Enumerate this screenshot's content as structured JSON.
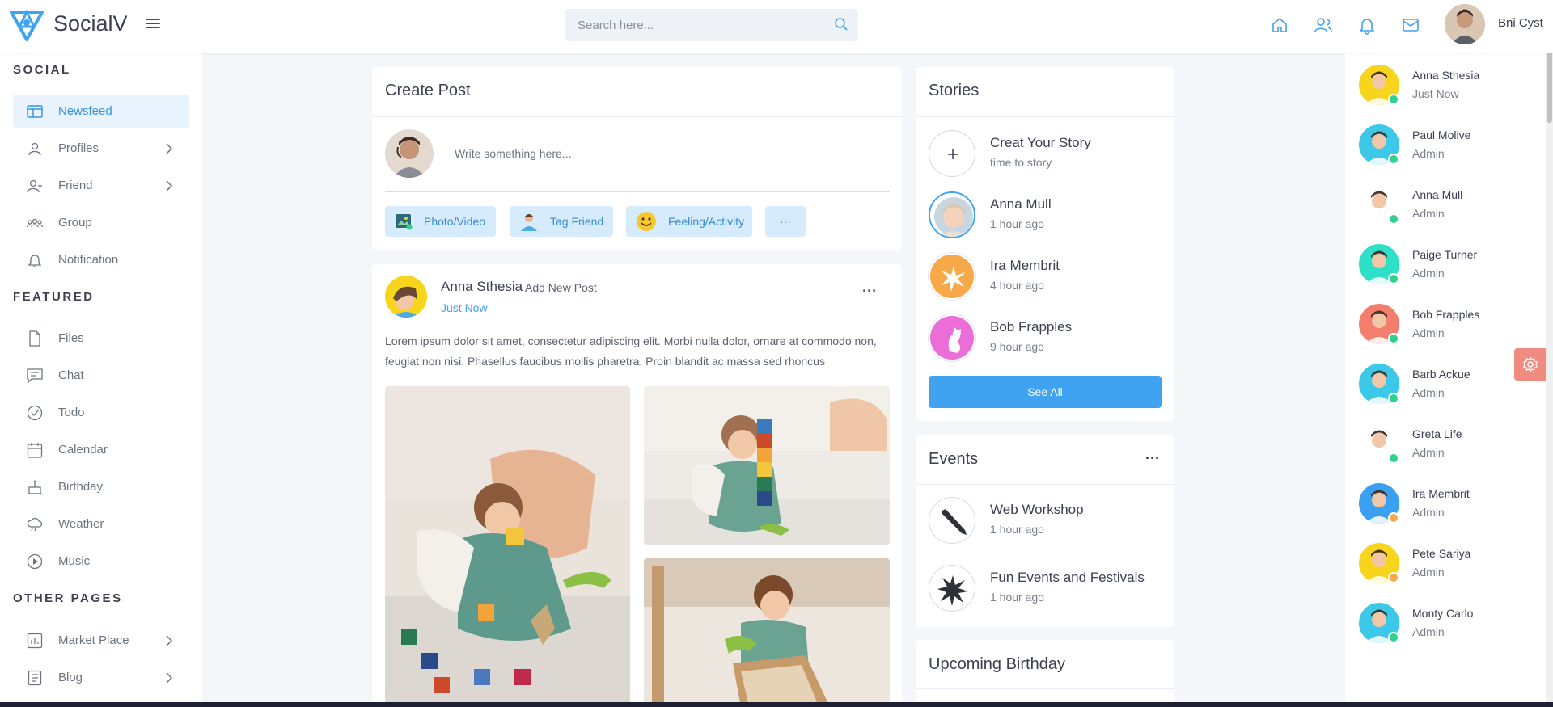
{
  "header": {
    "brand": "SocialV",
    "search_placeholder": "Search here...",
    "user_name": "Bni Cyst"
  },
  "sidebar": {
    "sections": [
      {
        "title": "SOCIAL"
      },
      {
        "title": "FEATURED"
      },
      {
        "title": "OTHER PAGES"
      }
    ],
    "items": [
      {
        "label": "Newsfeed",
        "icon": "newsfeed-icon",
        "active": true
      },
      {
        "label": "Profiles",
        "icon": "user-icon",
        "chevron": true
      },
      {
        "label": "Friend",
        "icon": "friends-icon",
        "chevron": true
      },
      {
        "label": "Group",
        "icon": "group-icon"
      },
      {
        "label": "Notification",
        "icon": "bell-icon"
      },
      {
        "label": "Files",
        "icon": "file-icon"
      },
      {
        "label": "Chat",
        "icon": "chat-icon"
      },
      {
        "label": "Todo",
        "icon": "check-circle-icon"
      },
      {
        "label": "Calendar",
        "icon": "calendar-icon"
      },
      {
        "label": "Birthday",
        "icon": "cake-icon"
      },
      {
        "label": "Weather",
        "icon": "weather-icon"
      },
      {
        "label": "Music",
        "icon": "play-icon"
      },
      {
        "label": "Market Place",
        "icon": "chart-icon",
        "chevron": true
      },
      {
        "label": "Blog",
        "icon": "document-icon",
        "chevron": true
      }
    ]
  },
  "create_post": {
    "title": "Create Post",
    "placeholder": "Write something here...",
    "actions": [
      {
        "label": "Photo/Video",
        "icon": "photo-icon"
      },
      {
        "label": "Tag Friend",
        "icon": "tag-friend-icon"
      },
      {
        "label": "Feeling/Activity",
        "icon": "smiley-icon"
      },
      {
        "label": "···",
        "icon": "more-icon"
      }
    ]
  },
  "post": {
    "author": "Anna Sthesia",
    "action": "Add New Post",
    "time": "Just Now",
    "text": "Lorem ipsum dolor sit amet, consectetur adipiscing elit. Morbi nulla dolor, ornare at commodo non, feugiat non nisi. Phasellus faucibus mollis pharetra. Proin blandit ac massa sed rhoncus",
    "more": "···"
  },
  "stories": {
    "title": "Stories",
    "items": [
      {
        "name": "Creat Your Story",
        "time": "time to story"
      },
      {
        "name": "Anna Mull",
        "time": "1 hour ago"
      },
      {
        "name": "Ira Membrit",
        "time": "4 hour ago"
      },
      {
        "name": "Bob Frapples",
        "time": "9 hour ago"
      }
    ],
    "see_all": "See All"
  },
  "events": {
    "title": "Events",
    "more": "···",
    "items": [
      {
        "name": "Web Workshop",
        "time": "1 hour ago"
      },
      {
        "name": "Fun Events and Festivals",
        "time": "1 hour ago"
      }
    ]
  },
  "birthday": {
    "title": "Upcoming Birthday"
  },
  "contacts": [
    {
      "name": "Anna Sthesia",
      "role": "Just Now",
      "status": "online",
      "color": "#f7d51d"
    },
    {
      "name": "Paul Molive",
      "role": "Admin",
      "status": "online",
      "color": "#3cc8e8"
    },
    {
      "name": "Anna Mull",
      "role": "Admin",
      "status": "online",
      "color": "#ffffff"
    },
    {
      "name": "Paige Turner",
      "role": "Admin",
      "status": "online",
      "color": "#2ee0c8"
    },
    {
      "name": "Bob Frapples",
      "role": "Admin",
      "status": "online",
      "color": "#f47e6d"
    },
    {
      "name": "Barb Ackue",
      "role": "Admin",
      "status": "online",
      "color": "#3cc8e8"
    },
    {
      "name": "Greta Life",
      "role": "Admin",
      "status": "online",
      "color": "#ffffff"
    },
    {
      "name": "Ira Membrit",
      "role": "Admin",
      "status": "away",
      "color": "#3aa0f0"
    },
    {
      "name": "Pete Sariya",
      "role": "Admin",
      "status": "away",
      "color": "#f7d51d"
    },
    {
      "name": "Monty Carlo",
      "role": "Admin",
      "status": "online",
      "color": "#3cc8e8"
    }
  ],
  "colors": {
    "accent": "#3fa3f2",
    "online": "#2fd28c",
    "away": "#f7a94a"
  }
}
